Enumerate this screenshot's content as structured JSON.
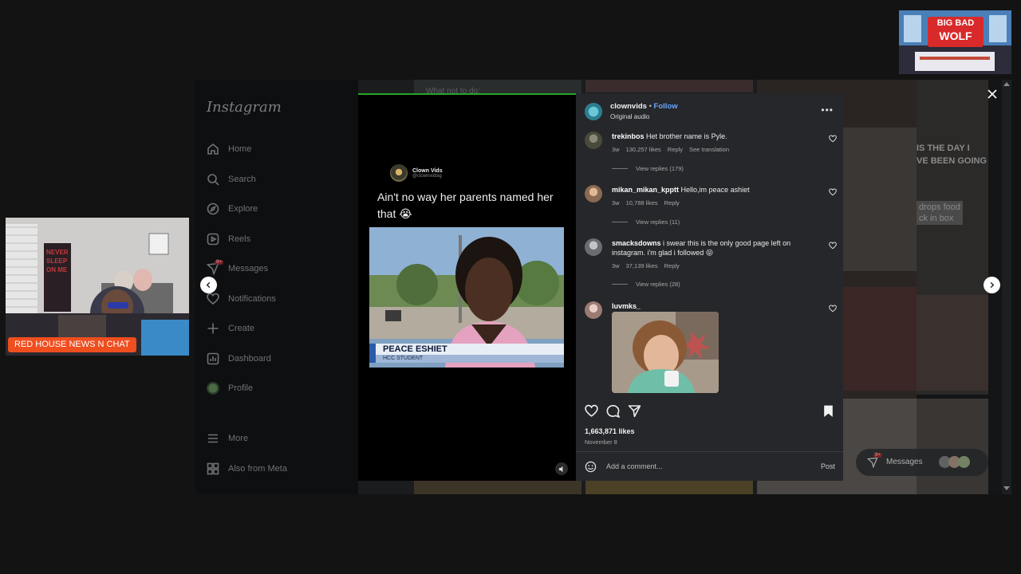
{
  "sidebar": {
    "logo": "Instagram",
    "items": [
      {
        "label": "Home",
        "icon": "home-icon"
      },
      {
        "label": "Search",
        "icon": "search-icon"
      },
      {
        "label": "Explore",
        "icon": "compass-icon"
      },
      {
        "label": "Reels",
        "icon": "reels-icon"
      },
      {
        "label": "Messages",
        "icon": "messenger-icon",
        "badge": "9+"
      },
      {
        "label": "Notifications",
        "icon": "heart-icon"
      },
      {
        "label": "Create",
        "icon": "plus-icon"
      },
      {
        "label": "Dashboard",
        "icon": "dashboard-icon"
      },
      {
        "label": "Profile",
        "icon": "avatar-icon"
      },
      {
        "label": "More",
        "icon": "menu-icon"
      },
      {
        "label": "Also from Meta",
        "icon": "meta-apps-icon"
      }
    ]
  },
  "feed_text": {
    "tile_a": "What not to do:",
    "tile_b": "IS THE DAY I\nVE BEEN GOING",
    "tile_c": "drops food\nck in box"
  },
  "post": {
    "video_author": "Clown Vids",
    "video_handle": "@clownvidsig",
    "video_caption": "Ain't no way her parents named her that 😭",
    "chyron_name": "PEACE ESHIET",
    "chyron_sub": "HCC STUDENT",
    "account": "clownvids",
    "follow_label": "Follow",
    "audio": "Original audio",
    "likes": "1,663,871 likes",
    "date": "November 8",
    "comment_placeholder": "Add a comment...",
    "post_label": "Post"
  },
  "comments": [
    {
      "user": "trekinbos",
      "text": "Het brother name is Pyle.",
      "age": "3w",
      "likes": "130,257 likes",
      "reply": "Reply",
      "extra": "See translation",
      "replies": "View replies (179)",
      "avatar_color": "#5a5a4a"
    },
    {
      "user": "mikan_mikan_kpptt",
      "text": "Hello,im peace ashiet",
      "age": "3w",
      "likes": "10,788 likes",
      "reply": "Reply",
      "extra": "",
      "replies": "View replies (11)",
      "avatar_color": "#b88a6a"
    },
    {
      "user": "smacksdowns",
      "text": "i swear this is the only good page left on instagram. i'm glad i followed 😝",
      "age": "3w",
      "likes": "37,139 likes",
      "reply": "Reply",
      "extra": "",
      "replies": "View replies (28)",
      "avatar_color": "#8c8f94"
    },
    {
      "user": "luvmks_",
      "text": "",
      "age": "",
      "likes": "",
      "reply": "",
      "extra": "",
      "replies": "",
      "avatar_color": "#c9a9a0"
    }
  ],
  "messages_pill": {
    "label": "Messages",
    "badge": "9+"
  },
  "overlays": {
    "webcam_label": "RED HOUSE NEWS N CHAT",
    "poster_text": "NEVER SLEEP ON ME",
    "logo_line1": "BIG BAD",
    "logo_line2": "WOLF"
  },
  "colors": {
    "accent_blue": "#6aa5ff",
    "panel_bg": "#25272a",
    "label_orange": "#ef4e1f"
  }
}
